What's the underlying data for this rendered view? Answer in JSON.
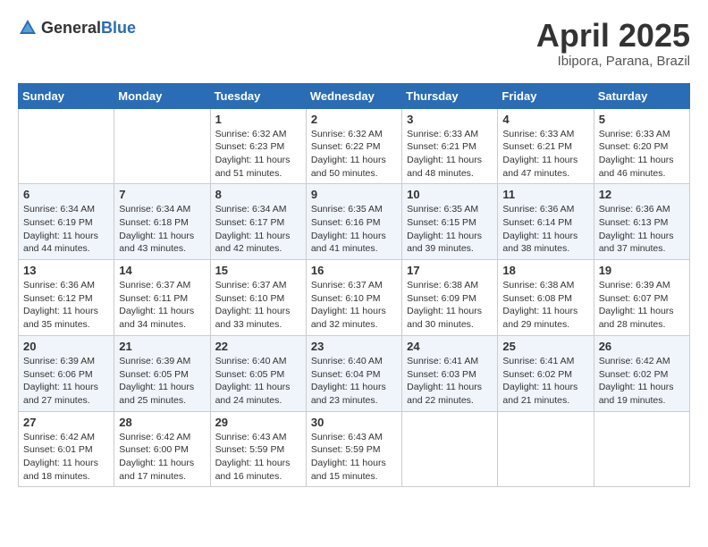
{
  "header": {
    "logo_general": "General",
    "logo_blue": "Blue",
    "month_year": "April 2025",
    "location": "Ibipora, Parana, Brazil"
  },
  "weekdays": [
    "Sunday",
    "Monday",
    "Tuesday",
    "Wednesday",
    "Thursday",
    "Friday",
    "Saturday"
  ],
  "weeks": [
    [
      {
        "day": "",
        "info": ""
      },
      {
        "day": "",
        "info": ""
      },
      {
        "day": "1",
        "info": "Sunrise: 6:32 AM\nSunset: 6:23 PM\nDaylight: 11 hours and 51 minutes."
      },
      {
        "day": "2",
        "info": "Sunrise: 6:32 AM\nSunset: 6:22 PM\nDaylight: 11 hours and 50 minutes."
      },
      {
        "day": "3",
        "info": "Sunrise: 6:33 AM\nSunset: 6:21 PM\nDaylight: 11 hours and 48 minutes."
      },
      {
        "day": "4",
        "info": "Sunrise: 6:33 AM\nSunset: 6:21 PM\nDaylight: 11 hours and 47 minutes."
      },
      {
        "day": "5",
        "info": "Sunrise: 6:33 AM\nSunset: 6:20 PM\nDaylight: 11 hours and 46 minutes."
      }
    ],
    [
      {
        "day": "6",
        "info": "Sunrise: 6:34 AM\nSunset: 6:19 PM\nDaylight: 11 hours and 44 minutes."
      },
      {
        "day": "7",
        "info": "Sunrise: 6:34 AM\nSunset: 6:18 PM\nDaylight: 11 hours and 43 minutes."
      },
      {
        "day": "8",
        "info": "Sunrise: 6:34 AM\nSunset: 6:17 PM\nDaylight: 11 hours and 42 minutes."
      },
      {
        "day": "9",
        "info": "Sunrise: 6:35 AM\nSunset: 6:16 PM\nDaylight: 11 hours and 41 minutes."
      },
      {
        "day": "10",
        "info": "Sunrise: 6:35 AM\nSunset: 6:15 PM\nDaylight: 11 hours and 39 minutes."
      },
      {
        "day": "11",
        "info": "Sunrise: 6:36 AM\nSunset: 6:14 PM\nDaylight: 11 hours and 38 minutes."
      },
      {
        "day": "12",
        "info": "Sunrise: 6:36 AM\nSunset: 6:13 PM\nDaylight: 11 hours and 37 minutes."
      }
    ],
    [
      {
        "day": "13",
        "info": "Sunrise: 6:36 AM\nSunset: 6:12 PM\nDaylight: 11 hours and 35 minutes."
      },
      {
        "day": "14",
        "info": "Sunrise: 6:37 AM\nSunset: 6:11 PM\nDaylight: 11 hours and 34 minutes."
      },
      {
        "day": "15",
        "info": "Sunrise: 6:37 AM\nSunset: 6:10 PM\nDaylight: 11 hours and 33 minutes."
      },
      {
        "day": "16",
        "info": "Sunrise: 6:37 AM\nSunset: 6:10 PM\nDaylight: 11 hours and 32 minutes."
      },
      {
        "day": "17",
        "info": "Sunrise: 6:38 AM\nSunset: 6:09 PM\nDaylight: 11 hours and 30 minutes."
      },
      {
        "day": "18",
        "info": "Sunrise: 6:38 AM\nSunset: 6:08 PM\nDaylight: 11 hours and 29 minutes."
      },
      {
        "day": "19",
        "info": "Sunrise: 6:39 AM\nSunset: 6:07 PM\nDaylight: 11 hours and 28 minutes."
      }
    ],
    [
      {
        "day": "20",
        "info": "Sunrise: 6:39 AM\nSunset: 6:06 PM\nDaylight: 11 hours and 27 minutes."
      },
      {
        "day": "21",
        "info": "Sunrise: 6:39 AM\nSunset: 6:05 PM\nDaylight: 11 hours and 25 minutes."
      },
      {
        "day": "22",
        "info": "Sunrise: 6:40 AM\nSunset: 6:05 PM\nDaylight: 11 hours and 24 minutes."
      },
      {
        "day": "23",
        "info": "Sunrise: 6:40 AM\nSunset: 6:04 PM\nDaylight: 11 hours and 23 minutes."
      },
      {
        "day": "24",
        "info": "Sunrise: 6:41 AM\nSunset: 6:03 PM\nDaylight: 11 hours and 22 minutes."
      },
      {
        "day": "25",
        "info": "Sunrise: 6:41 AM\nSunset: 6:02 PM\nDaylight: 11 hours and 21 minutes."
      },
      {
        "day": "26",
        "info": "Sunrise: 6:42 AM\nSunset: 6:02 PM\nDaylight: 11 hours and 19 minutes."
      }
    ],
    [
      {
        "day": "27",
        "info": "Sunrise: 6:42 AM\nSunset: 6:01 PM\nDaylight: 11 hours and 18 minutes."
      },
      {
        "day": "28",
        "info": "Sunrise: 6:42 AM\nSunset: 6:00 PM\nDaylight: 11 hours and 17 minutes."
      },
      {
        "day": "29",
        "info": "Sunrise: 6:43 AM\nSunset: 5:59 PM\nDaylight: 11 hours and 16 minutes."
      },
      {
        "day": "30",
        "info": "Sunrise: 6:43 AM\nSunset: 5:59 PM\nDaylight: 11 hours and 15 minutes."
      },
      {
        "day": "",
        "info": ""
      },
      {
        "day": "",
        "info": ""
      },
      {
        "day": "",
        "info": ""
      }
    ]
  ]
}
